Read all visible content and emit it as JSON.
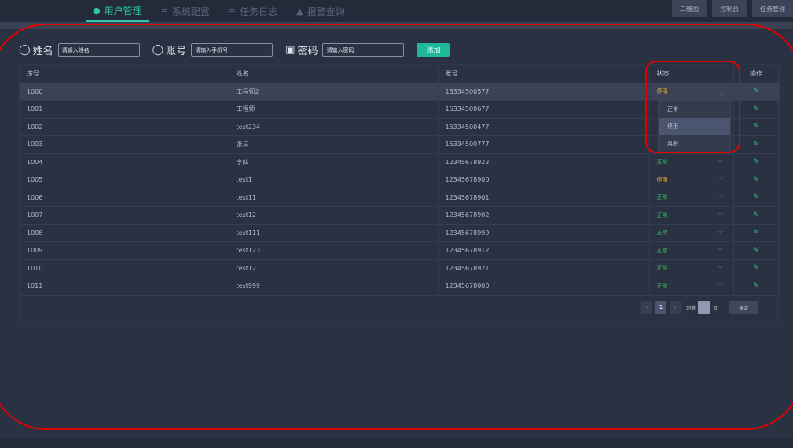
{
  "nav": {
    "tabs": [
      {
        "label": "用户管理",
        "icon": "user-icon",
        "active": true
      },
      {
        "label": "系统配置",
        "icon": "settings-icon",
        "active": false
      },
      {
        "label": "任务日志",
        "icon": "list-icon",
        "active": false
      },
      {
        "label": "报警查询",
        "icon": "warning-icon",
        "active": false
      }
    ],
    "buttons": [
      "二维图",
      "控制台",
      "任务管理"
    ]
  },
  "form": {
    "name_label": "姓名",
    "name_placeholder": "请输入姓名",
    "account_label": "账号",
    "account_placeholder": "请输入手机号",
    "password_label": "密码",
    "password_placeholder": "请输入密码",
    "add_label": "添加"
  },
  "table": {
    "headers": [
      "序号",
      "姓名",
      "账号",
      "状态",
      "操作"
    ],
    "rows": [
      {
        "id": "1000",
        "name": "工程师2",
        "account": "15334500577",
        "status": "停用"
      },
      {
        "id": "1001",
        "name": "工程师",
        "account": "15334500677",
        "status": ""
      },
      {
        "id": "1002",
        "name": "test234",
        "account": "15334500477",
        "status": ""
      },
      {
        "id": "1003",
        "name": "张三",
        "account": "15334500777",
        "status": ""
      },
      {
        "id": "1004",
        "name": "李四",
        "account": "12345678922",
        "status": "正常"
      },
      {
        "id": "1005",
        "name": "test1",
        "account": "12345678900",
        "status": "停用"
      },
      {
        "id": "1006",
        "name": "test11",
        "account": "12345678901",
        "status": "正常"
      },
      {
        "id": "1007",
        "name": "test12",
        "account": "12345678902",
        "status": "正常"
      },
      {
        "id": "1008",
        "name": "test111",
        "account": "12345678999",
        "status": "正常"
      },
      {
        "id": "1009",
        "name": "test123",
        "account": "12345678912",
        "status": "正常"
      },
      {
        "id": "1010",
        "name": "test12",
        "account": "12345678921",
        "status": "正常"
      },
      {
        "id": "1011",
        "name": "test999",
        "account": "12345678000",
        "status": "正常"
      }
    ]
  },
  "status_dropdown": {
    "options": [
      "正常",
      "停用",
      "离职"
    ],
    "selected": "停用"
  },
  "pagination": {
    "prev": "‹",
    "current": "1",
    "next": "›",
    "goto_label": "到第",
    "page_label": "页",
    "confirm_label": "确定"
  },
  "colors": {
    "accent": "#2fc6a6",
    "status_normal": "#28c84f",
    "status_disabled": "#f5b32a",
    "highlight": "#e50000"
  }
}
